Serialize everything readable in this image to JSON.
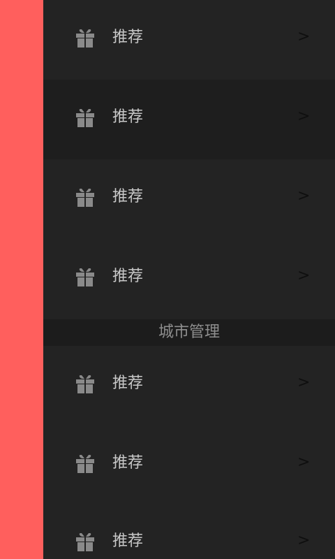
{
  "colors": {
    "accent_strip": "#ff5f5d",
    "menu_bg": "#232323",
    "menu_bg_alt": "#1e1e1e",
    "section_bg": "#1c1c1c",
    "label_text": "#c8c8c8",
    "section_text": "#8e8e8e",
    "chevron": "#0f0f0f",
    "icon": "#8a8a8a"
  },
  "menu": {
    "items": [
      {
        "icon": "gift-icon",
        "label": "推荐",
        "chevron": ">"
      },
      {
        "icon": "gift-icon",
        "label": "推荐",
        "chevron": ">"
      },
      {
        "icon": "gift-icon",
        "label": "推荐",
        "chevron": ">"
      },
      {
        "icon": "gift-icon",
        "label": "推荐",
        "chevron": ">"
      }
    ],
    "section_title": "城市管理",
    "items2": [
      {
        "icon": "gift-icon",
        "label": "推荐",
        "chevron": ">"
      },
      {
        "icon": "gift-icon",
        "label": "推荐",
        "chevron": ">"
      },
      {
        "icon": "gift-icon",
        "label": "推荐",
        "chevron": ">"
      }
    ]
  }
}
